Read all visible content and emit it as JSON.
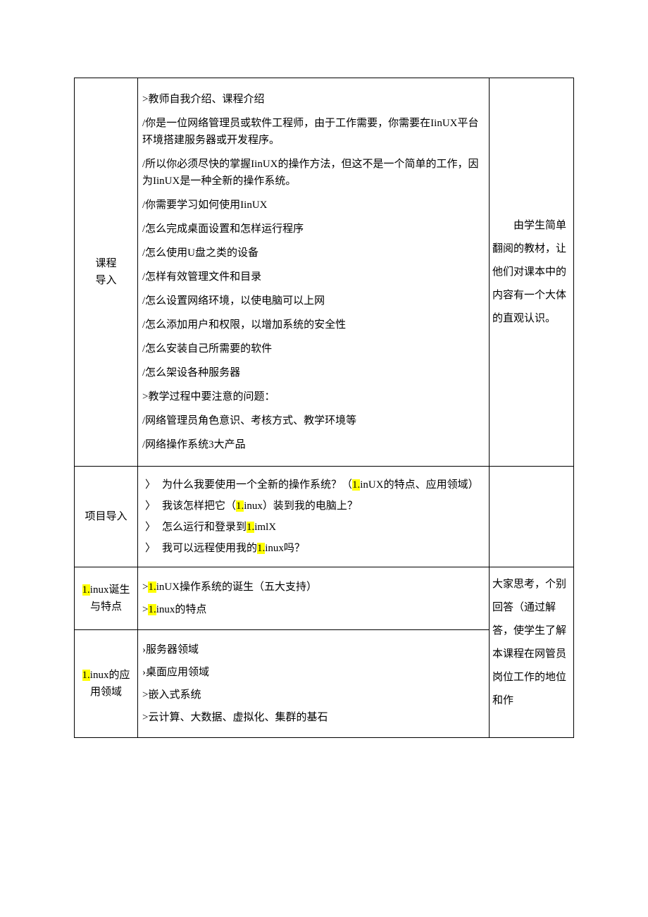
{
  "rows": {
    "intro": {
      "label_line1": "课程",
      "label_line2": "导入",
      "content": {
        "p1": ">教师自我介绍、课程介绍",
        "p2": "/你是一位网络管理员或软件工程师，由于工作需要，你需要在IinUX平台环境搭建服务器或开发程序。",
        "p3": "/所以你必须尽快的掌握IinUX的操作方法，但这不是一个简单的工作，因为IinUX是一种全新的操作系统。",
        "p4": "/你需要学习如何使用IinUX",
        "p5": "/怎么完成桌面设置和怎样运行程序",
        "p6": "/怎么使用U盘之类的设备",
        "p7": "/怎样有效管理文件和目录",
        "p8": "/怎么设置网络环境，以使电脑可以上网",
        "p9": "/怎么添加用户和权限，以增加系统的安全性",
        "p10": "/怎么安装自己所需要的软件",
        "p11": "/怎么架设各种服务器",
        "p12": ">教学过程中要注意的问题：",
        "p13": "/网络管理员角色意识、考核方式、教学环境等",
        "p14": "/网络操作系统3大产品"
      },
      "note": "　　由学生简单翻阅的教材，让他们对课本中的内容有一个大体的直观认识。"
    },
    "project": {
      "label": "项目导入",
      "items": {
        "a_pre": "为什么我要使用一个全新的操作系统？（",
        "a_hl": "1.",
        "a_post": "inUX的特点、应用领域）",
        "b_pre": "我该怎样把它（",
        "b_hl": "1.",
        "b_post": "inux）装到我的电脑上？",
        "c_pre": "怎么运行和登录到",
        "c_hl": "1.",
        "c_post": "imlX",
        "d_pre": "我可以远程使用我的",
        "d_hl": "1.",
        "d_post": "inux吗？"
      },
      "arrow": "〉"
    },
    "birth": {
      "label_hl": "1.",
      "label_rest": "inux诞生与特点",
      "l1_pre": ">",
      "l1_hl": "1.",
      "l1_post": "inUX操作系统的诞生（五大支持）",
      "l2_pre": ">",
      "l2_hl": "1.",
      "l2_post": "inux的特点"
    },
    "domain": {
      "label_hl": "1.",
      "label_rest": "inux的应用领域",
      "l1": "›服务器领域",
      "l2": "›桌面应用领域",
      "l3": ">嵌入式系统",
      "l4": ">云计算、大数据、虚拟化、集群的基石"
    },
    "rightnote2": "大家思考，个别回答（通过解答，使学生了解本课程在网管员岗位工作的地位和作"
  }
}
